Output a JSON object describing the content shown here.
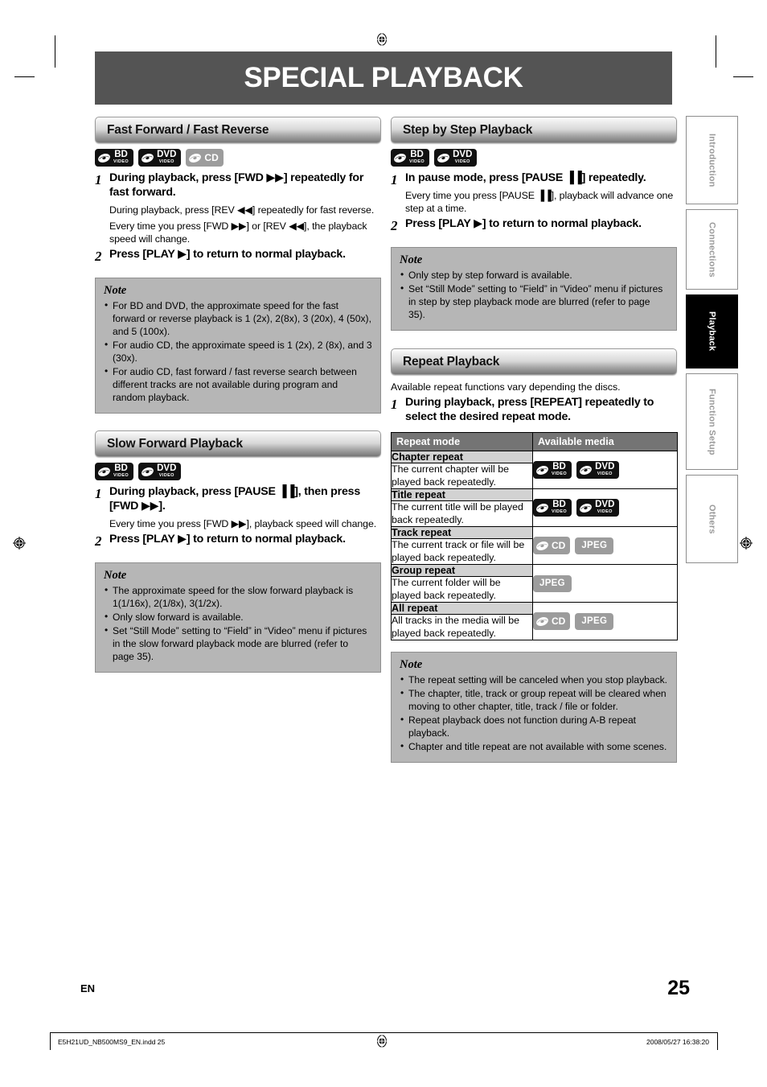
{
  "page": {
    "title": "SPECIAL PLAYBACK",
    "language_code": "EN",
    "page_number": "25",
    "footer_file": "E5H21UD_NB500MS9_EN.indd   25",
    "footer_timestamp": "2008/05/27   16:38:20"
  },
  "colors": {
    "title_bar": "#545454",
    "note_box": "#b6b6b6",
    "table_header": "#747474",
    "mode_cell": "#d2d2d2",
    "badge_dark": "#111111",
    "badge_grey": "#9c9c9c",
    "active_tab": "#000000"
  },
  "tabs": [
    {
      "label": "Introduction",
      "active": false
    },
    {
      "label": "Connections",
      "active": false
    },
    {
      "label": "Playback",
      "active": true
    },
    {
      "label": "Function Setup",
      "active": false
    },
    {
      "label": "Others",
      "active": false
    }
  ],
  "sections": {
    "fast_forward": {
      "heading": "Fast Forward / Fast Reverse",
      "media": [
        "BD Video",
        "DVD Video",
        "CD"
      ],
      "steps": [
        {
          "num": "1",
          "head_parts": [
            "During playback, press [FWD ",
            "▶▶",
            "] repeatedly for fast forward."
          ],
          "head_plain": "During playback, press [FWD ▶▶] repeatedly for fast forward.",
          "paras": [
            "During playback, press [REV ◀◀] repeatedly for fast reverse.",
            "Every time you press [FWD ▶▶] or [REV ◀◀], the playback speed will change."
          ]
        },
        {
          "num": "2",
          "head_plain": "Press [PLAY ▶] to return to normal playback.",
          "paras": []
        }
      ],
      "note": {
        "title": "Note",
        "items": [
          "For BD and DVD, the approximate speed for the fast forward or reverse playback is 1 (2x), 2(8x), 3 (20x), 4 (50x), and 5 (100x).",
          "For audio CD, the approximate speed is 1 (2x), 2 (8x), and 3 (30x).",
          "For audio CD, fast forward / fast reverse search between different tracks are not available during program and random playback."
        ]
      }
    },
    "slow_forward": {
      "heading": "Slow Forward Playback",
      "media": [
        "BD Video",
        "DVD Video"
      ],
      "steps": [
        {
          "num": "1",
          "head_plain": "During playback, press [PAUSE ▐▐], then press [FWD ▶▶].",
          "paras": [
            "Every time you press [FWD ▶▶], playback speed will change."
          ]
        },
        {
          "num": "2",
          "head_plain": "Press [PLAY ▶] to return to normal playback.",
          "paras": []
        }
      ],
      "note": {
        "title": "Note",
        "items": [
          "The approximate speed for the slow forward playback is 1(1/16x), 2(1/8x), 3(1/2x).",
          "Only slow forward is available.",
          "Set “Still Mode” setting to “Field” in “Video” menu if pictures in the slow forward playback mode are blurred (refer to page 35)."
        ]
      }
    },
    "step_by_step": {
      "heading": "Step by Step Playback",
      "media": [
        "BD Video",
        "DVD Video"
      ],
      "steps": [
        {
          "num": "1",
          "head_plain": "In pause mode, press [PAUSE ▐▐] repeatedly.",
          "paras": [
            "Every time you press [PAUSE ▐▐], playback will advance one step at a time."
          ]
        },
        {
          "num": "2",
          "head_plain": "Press [PLAY ▶] to return to normal playback.",
          "paras": []
        }
      ],
      "note": {
        "title": "Note",
        "items": [
          "Only step by step forward is available.",
          "Set “Still Mode” setting to “Field” in “Video” menu if pictures in step by step playback mode are blurred (refer to page 35)."
        ]
      }
    },
    "repeat": {
      "heading": "Repeat Playback",
      "lead": "Available repeat functions vary depending the discs.",
      "steps": [
        {
          "num": "1",
          "head_plain": "During playback, press [REPEAT] repeatedly to select the desired repeat mode.",
          "paras": []
        }
      ],
      "table": {
        "headers": [
          "Repeat mode",
          "Available media"
        ],
        "rows": [
          {
            "mode": "Chapter repeat",
            "desc": "The current chapter will be played back repeatedly.",
            "media": [
              "BD Video",
              "DVD Video"
            ]
          },
          {
            "mode": "Title repeat",
            "desc": "The current title will be played back repeatedly.",
            "media": [
              "BD Video",
              "DVD Video"
            ]
          },
          {
            "mode": "Track repeat",
            "desc": "The current track or file will be played back repeatedly.",
            "media": [
              "CD",
              "JPEG"
            ]
          },
          {
            "mode": "Group repeat",
            "desc": "The current folder will be played back repeatedly.",
            "media": [
              "JPEG"
            ]
          },
          {
            "mode": "All repeat",
            "desc": "All tracks in the media will be played back repeatedly.",
            "media": [
              "CD",
              "JPEG"
            ]
          }
        ]
      },
      "note": {
        "title": "Note",
        "items": [
          "The repeat setting will be canceled when you stop playback.",
          "The chapter, title, track or group repeat will be cleared when moving to other chapter, title, track / file or folder.",
          "Repeat playback does not function during A-B repeat playback.",
          "Chapter and title repeat are not available with some scenes."
        ]
      }
    }
  }
}
